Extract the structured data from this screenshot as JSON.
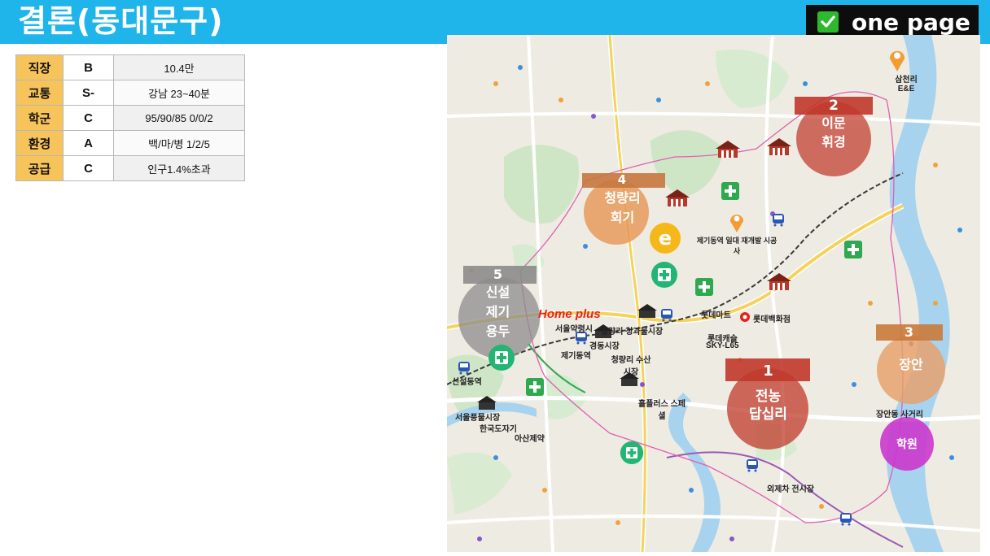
{
  "header": {
    "title": "결론(동대문구)",
    "badge_label": "one page"
  },
  "summary_table": [
    {
      "category": "직장",
      "grade": "B",
      "value": "10.4만"
    },
    {
      "category": "교통",
      "grade": "S-",
      "value": "강남 23~40분"
    },
    {
      "category": "학군",
      "grade": "C",
      "value": "95/90/85 0/0/2"
    },
    {
      "category": "환경",
      "grade": "A",
      "value": "백/마/병 1/2/5"
    },
    {
      "category": "공급",
      "grade": "C",
      "value": "인구1.4%초과"
    }
  ],
  "map": {
    "zones": [
      {
        "number": "1",
        "line1": "전농",
        "line2": "답십리"
      },
      {
        "number": "2",
        "line1": "이문",
        "line2": "휘경"
      },
      {
        "number": "3",
        "line1": "장안",
        "line2": ""
      },
      {
        "number": "4",
        "line1": "청량리",
        "line2": "회기"
      },
      {
        "number": "5",
        "line1": "신설",
        "line2": "제기",
        "line3": "용두"
      }
    ],
    "academy_label": "학원",
    "places": {
      "home_plus": "Home plus",
      "home_plus_sub": "서울약령시",
      "lotte_mart": "롯데마트",
      "lotte_dept": "롯데백화점",
      "lotte_castle": "롯데캐슬",
      "sky_l65": "SKY-L65",
      "cheongnyangni_market": "청량리 청과물시장",
      "gyeongdong_market": "경동시장",
      "susan_market": "청량리 수산시장",
      "seoul_pungmul": "서울풍물시장",
      "hanguk_doja": "한국도자기",
      "asan_pharm": "아산제약",
      "holy_land": "홀플러스 스페셜",
      "samcheonri": "삼천리 E&E",
      "jangan_intersection": "장안동 사거리",
      "oeje_market": "외제차 전시장",
      "jongno_station": "신설동역",
      "gyeongdong_station": "제기동역",
      "jaegae": "재개발 사업",
      "redevelop": "제기동역 일대 재개발 시공사"
    },
    "colors": {
      "zone1": "#c0392b",
      "zone2": "#c0392b",
      "zone3": "#e8a06a",
      "zone4": "#e69554",
      "zone5": "#8c8c8c",
      "academy": "#cc33cc"
    }
  }
}
